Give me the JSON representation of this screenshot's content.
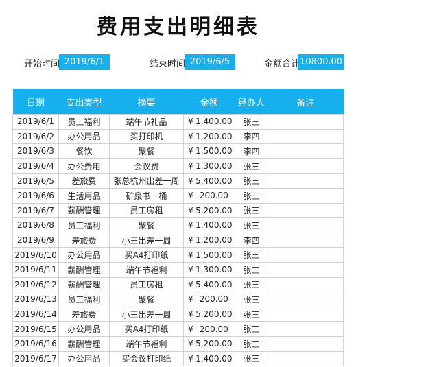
{
  "title": "费用支出明细表",
  "summary": {
    "start_label": "开始时间",
    "start_value": "2019/6/1",
    "end_label": "结束时间",
    "end_value": "2019/6/5",
    "total_label": "金额合计",
    "total_value": "10800.00"
  },
  "table": {
    "headers": [
      "日期",
      "支出类型",
      "摘要",
      "金额",
      "经办人",
      "备注"
    ],
    "currency_symbol": "¥",
    "rows": [
      {
        "date": "2019/6/1",
        "type": "员工福利",
        "summary": "端午节礼品",
        "amount": "1,400.00",
        "handler": "张三",
        "note": ""
      },
      {
        "date": "2019/6/2",
        "type": "办公用品",
        "summary": "买打印机",
        "amount": "1,200.00",
        "handler": "李四",
        "note": ""
      },
      {
        "date": "2019/6/3",
        "type": "餐饮",
        "summary": "聚餐",
        "amount": "1,500.00",
        "handler": "李四",
        "note": ""
      },
      {
        "date": "2019/6/4",
        "type": "办公费用",
        "summary": "会议费",
        "amount": "1,300.00",
        "handler": "张三",
        "note": ""
      },
      {
        "date": "2019/6/5",
        "type": "差旅费",
        "summary": "张总杭州出差一周",
        "amount": "5,400.00",
        "handler": "张三",
        "note": ""
      },
      {
        "date": "2019/6/6",
        "type": "生活用品",
        "summary": "矿泉书一桶",
        "amount": "200.00",
        "handler": "张三",
        "note": ""
      },
      {
        "date": "2019/6/7",
        "type": "薪酬管理",
        "summary": "员工房租",
        "amount": "5,200.00",
        "handler": "张三",
        "note": ""
      },
      {
        "date": "2019/6/8",
        "type": "员工福利",
        "summary": "聚餐",
        "amount": "1,400.00",
        "handler": "张三",
        "note": ""
      },
      {
        "date": "2019/6/9",
        "type": "差旅费",
        "summary": "小王出差一周",
        "amount": "1,200.00",
        "handler": "李四",
        "note": ""
      },
      {
        "date": "2019/6/10",
        "type": "办公用品",
        "summary": "买A4打印纸",
        "amount": "1,500.00",
        "handler": "张三",
        "note": ""
      },
      {
        "date": "2019/6/11",
        "type": "薪酬管理",
        "summary": "端午节福利",
        "amount": "1,300.00",
        "handler": "张三",
        "note": ""
      },
      {
        "date": "2019/6/12",
        "type": "薪酬管理",
        "summary": "员工房租",
        "amount": "5,400.00",
        "handler": "张三",
        "note": ""
      },
      {
        "date": "2019/6/13",
        "type": "员工福利",
        "summary": "聚餐",
        "amount": "200.00",
        "handler": "张三",
        "note": ""
      },
      {
        "date": "2019/6/14",
        "type": "差旅费",
        "summary": "小王出差一周",
        "amount": "5,200.00",
        "handler": "张三",
        "note": ""
      },
      {
        "date": "2019/6/15",
        "type": "办公用品",
        "summary": "买A4打印纸",
        "amount": "200.00",
        "handler": "张三",
        "note": ""
      },
      {
        "date": "2019/6/16",
        "type": "薪酬管理",
        "summary": "端午节福利",
        "amount": "5,200.00",
        "handler": "张三",
        "note": ""
      },
      {
        "date": "2019/6/17",
        "type": "办公用品",
        "summary": "买会议打印纸",
        "amount": "1,400.00",
        "handler": "张三",
        "note": ""
      }
    ]
  }
}
